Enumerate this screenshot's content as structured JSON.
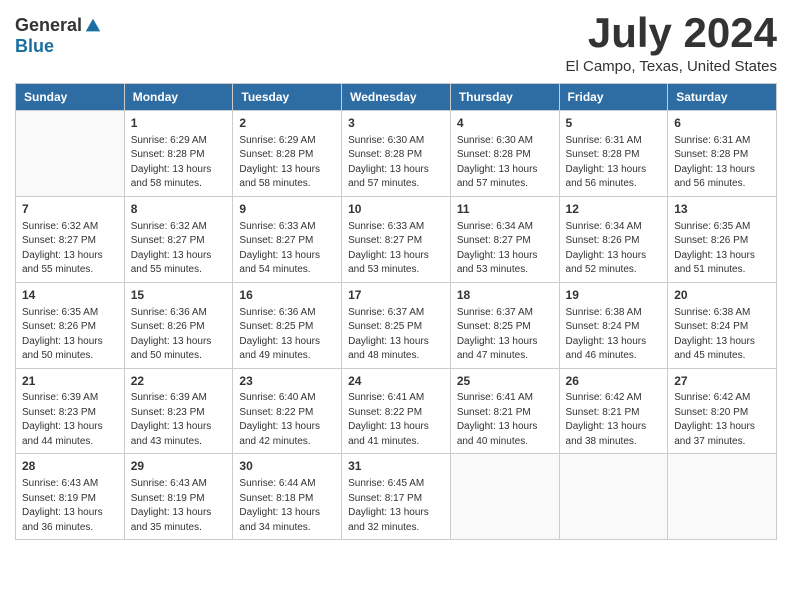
{
  "header": {
    "logo_general": "General",
    "logo_blue": "Blue",
    "month_year": "July 2024",
    "location": "El Campo, Texas, United States"
  },
  "days_of_week": [
    "Sunday",
    "Monday",
    "Tuesday",
    "Wednesday",
    "Thursday",
    "Friday",
    "Saturday"
  ],
  "weeks": [
    [
      {
        "day": "",
        "info": ""
      },
      {
        "day": "1",
        "info": "Sunrise: 6:29 AM\nSunset: 8:28 PM\nDaylight: 13 hours\nand 58 minutes."
      },
      {
        "day": "2",
        "info": "Sunrise: 6:29 AM\nSunset: 8:28 PM\nDaylight: 13 hours\nand 58 minutes."
      },
      {
        "day": "3",
        "info": "Sunrise: 6:30 AM\nSunset: 8:28 PM\nDaylight: 13 hours\nand 57 minutes."
      },
      {
        "day": "4",
        "info": "Sunrise: 6:30 AM\nSunset: 8:28 PM\nDaylight: 13 hours\nand 57 minutes."
      },
      {
        "day": "5",
        "info": "Sunrise: 6:31 AM\nSunset: 8:28 PM\nDaylight: 13 hours\nand 56 minutes."
      },
      {
        "day": "6",
        "info": "Sunrise: 6:31 AM\nSunset: 8:28 PM\nDaylight: 13 hours\nand 56 minutes."
      }
    ],
    [
      {
        "day": "7",
        "info": "Sunrise: 6:32 AM\nSunset: 8:27 PM\nDaylight: 13 hours\nand 55 minutes."
      },
      {
        "day": "8",
        "info": "Sunrise: 6:32 AM\nSunset: 8:27 PM\nDaylight: 13 hours\nand 55 minutes."
      },
      {
        "day": "9",
        "info": "Sunrise: 6:33 AM\nSunset: 8:27 PM\nDaylight: 13 hours\nand 54 minutes."
      },
      {
        "day": "10",
        "info": "Sunrise: 6:33 AM\nSunset: 8:27 PM\nDaylight: 13 hours\nand 53 minutes."
      },
      {
        "day": "11",
        "info": "Sunrise: 6:34 AM\nSunset: 8:27 PM\nDaylight: 13 hours\nand 53 minutes."
      },
      {
        "day": "12",
        "info": "Sunrise: 6:34 AM\nSunset: 8:26 PM\nDaylight: 13 hours\nand 52 minutes."
      },
      {
        "day": "13",
        "info": "Sunrise: 6:35 AM\nSunset: 8:26 PM\nDaylight: 13 hours\nand 51 minutes."
      }
    ],
    [
      {
        "day": "14",
        "info": "Sunrise: 6:35 AM\nSunset: 8:26 PM\nDaylight: 13 hours\nand 50 minutes."
      },
      {
        "day": "15",
        "info": "Sunrise: 6:36 AM\nSunset: 8:26 PM\nDaylight: 13 hours\nand 50 minutes."
      },
      {
        "day": "16",
        "info": "Sunrise: 6:36 AM\nSunset: 8:25 PM\nDaylight: 13 hours\nand 49 minutes."
      },
      {
        "day": "17",
        "info": "Sunrise: 6:37 AM\nSunset: 8:25 PM\nDaylight: 13 hours\nand 48 minutes."
      },
      {
        "day": "18",
        "info": "Sunrise: 6:37 AM\nSunset: 8:25 PM\nDaylight: 13 hours\nand 47 minutes."
      },
      {
        "day": "19",
        "info": "Sunrise: 6:38 AM\nSunset: 8:24 PM\nDaylight: 13 hours\nand 46 minutes."
      },
      {
        "day": "20",
        "info": "Sunrise: 6:38 AM\nSunset: 8:24 PM\nDaylight: 13 hours\nand 45 minutes."
      }
    ],
    [
      {
        "day": "21",
        "info": "Sunrise: 6:39 AM\nSunset: 8:23 PM\nDaylight: 13 hours\nand 44 minutes."
      },
      {
        "day": "22",
        "info": "Sunrise: 6:39 AM\nSunset: 8:23 PM\nDaylight: 13 hours\nand 43 minutes."
      },
      {
        "day": "23",
        "info": "Sunrise: 6:40 AM\nSunset: 8:22 PM\nDaylight: 13 hours\nand 42 minutes."
      },
      {
        "day": "24",
        "info": "Sunrise: 6:41 AM\nSunset: 8:22 PM\nDaylight: 13 hours\nand 41 minutes."
      },
      {
        "day": "25",
        "info": "Sunrise: 6:41 AM\nSunset: 8:21 PM\nDaylight: 13 hours\nand 40 minutes."
      },
      {
        "day": "26",
        "info": "Sunrise: 6:42 AM\nSunset: 8:21 PM\nDaylight: 13 hours\nand 38 minutes."
      },
      {
        "day": "27",
        "info": "Sunrise: 6:42 AM\nSunset: 8:20 PM\nDaylight: 13 hours\nand 37 minutes."
      }
    ],
    [
      {
        "day": "28",
        "info": "Sunrise: 6:43 AM\nSunset: 8:19 PM\nDaylight: 13 hours\nand 36 minutes."
      },
      {
        "day": "29",
        "info": "Sunrise: 6:43 AM\nSunset: 8:19 PM\nDaylight: 13 hours\nand 35 minutes."
      },
      {
        "day": "30",
        "info": "Sunrise: 6:44 AM\nSunset: 8:18 PM\nDaylight: 13 hours\nand 34 minutes."
      },
      {
        "day": "31",
        "info": "Sunrise: 6:45 AM\nSunset: 8:17 PM\nDaylight: 13 hours\nand 32 minutes."
      },
      {
        "day": "",
        "info": ""
      },
      {
        "day": "",
        "info": ""
      },
      {
        "day": "",
        "info": ""
      }
    ]
  ]
}
